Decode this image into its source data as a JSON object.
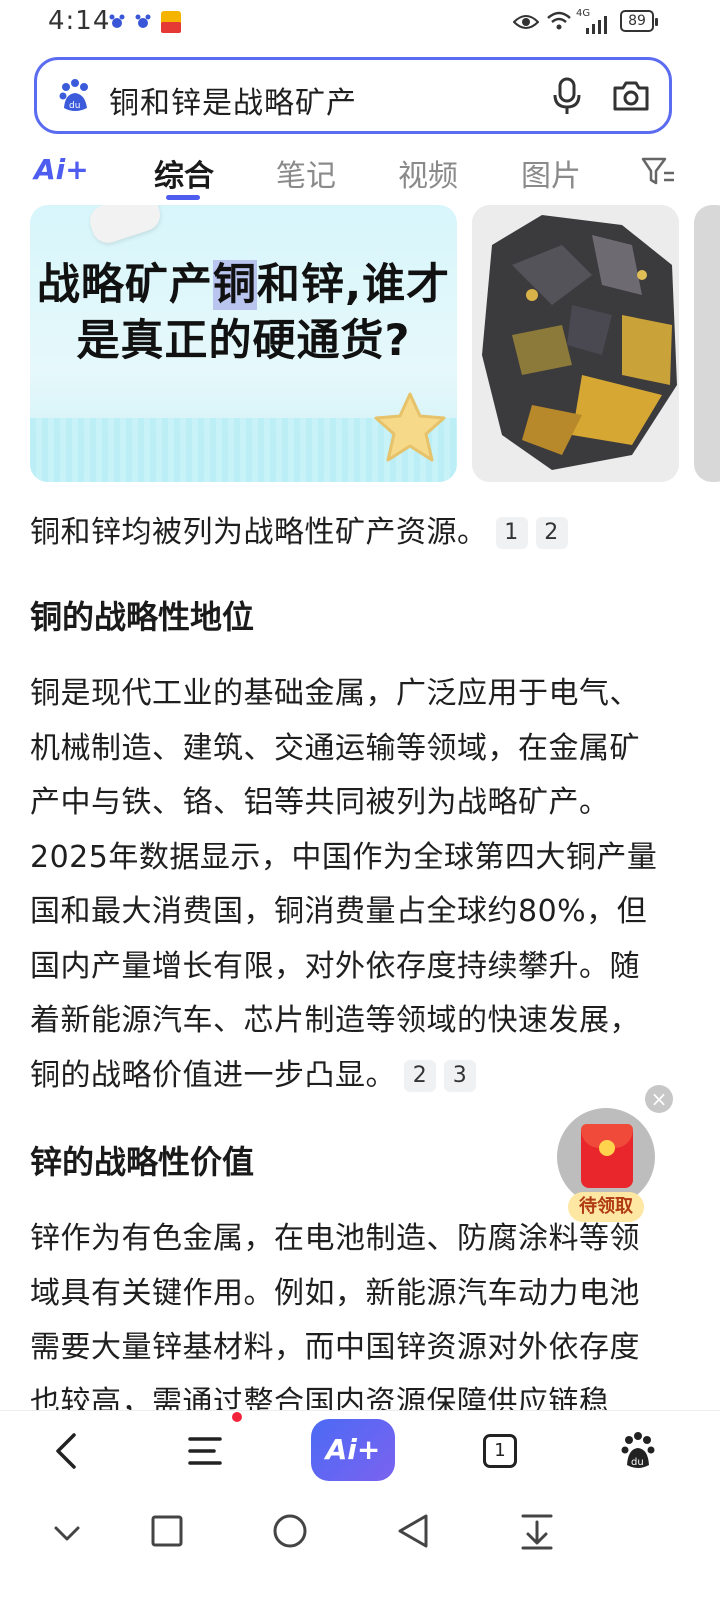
{
  "status_bar": {
    "time": "4:14",
    "battery": "89",
    "network": "4G"
  },
  "search": {
    "query": "铜和锌是战略矿产"
  },
  "tabs": {
    "ai_label": "Ai+",
    "items": [
      "综合",
      "笔记",
      "视频",
      "图片"
    ],
    "active": "综合"
  },
  "images": {
    "main_title_line1_a": "战略矿产",
    "main_title_line1_hl": "铜",
    "main_title_line1_b": "和锌,谁才",
    "main_title_line2": "是真正的硬通货?"
  },
  "article": {
    "summary": "铜和锌均被列为战略性矿产资源。",
    "summary_cites": [
      "1",
      "2"
    ],
    "section1_heading": "铜的战略性地位",
    "section1_text": "铜是现代工业的基础金属，广泛应用于电气、机械制造、建筑、交通运输等领域，在金属矿产中与铁、铬、铝等共同被列为战略矿产。2025年数据显示，中国作为全球第四大铜产量国和最大消费国，铜消费量占全球约80%，但国内产量增长有限，对外依存度持续攀升。随着新能源汽车、芯片制造等领域的快速发展，铜的战略价值进一步凸显。",
    "section1_cites": [
      "2",
      "3"
    ],
    "section2_heading": "锌的战略性价值",
    "section2_text": "锌作为有色金属，在电池制造、防腐涂料等领域具有关键作用。例如，新能源汽车动力电池需要大量锌基材料，而中国锌资源对外依存度也较高，需通过整合国内资源保障供应链稳"
  },
  "floating": {
    "close": "×",
    "label": "待领取"
  },
  "bottom_nav": {
    "ai_label": "Ai+",
    "tab_count": "1"
  },
  "colors": {
    "accent": "#4e5cf0",
    "search_border": "#5b6cf0",
    "notify_dot": "#f2233a"
  }
}
